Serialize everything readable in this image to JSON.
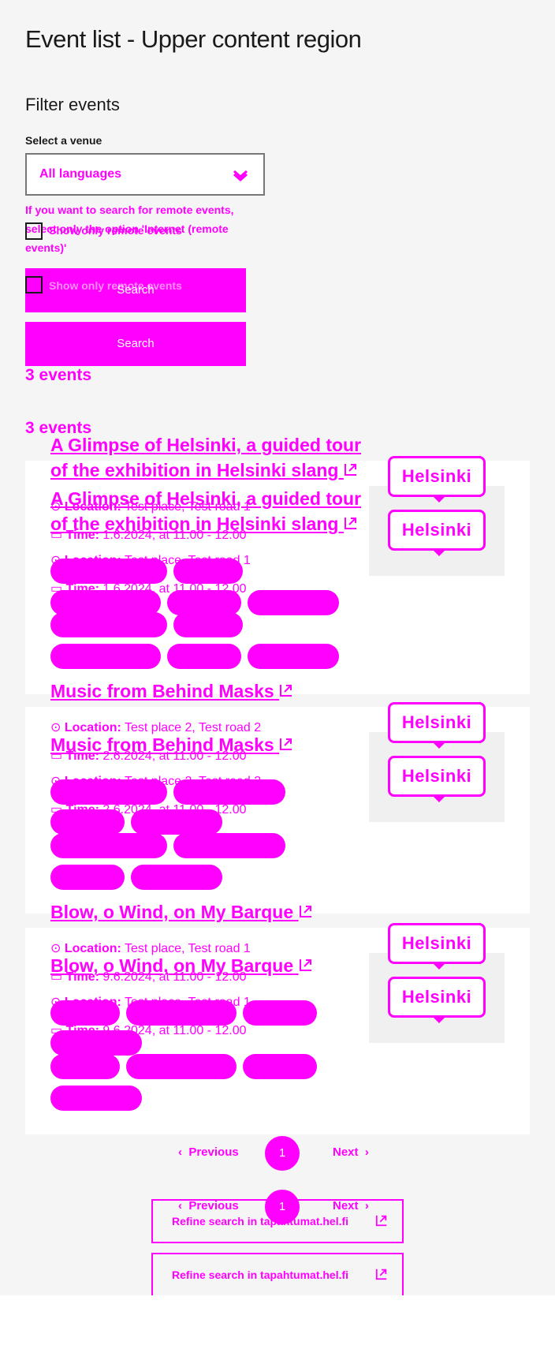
{
  "page": {
    "heading": "Event list - Upper content region"
  },
  "filters": {
    "heading": "Filter events",
    "venue_label": "Select a venue",
    "venue_value": "All languages",
    "helper_text": "If you want to search for remote events, select only the option 'Internet (remote events)'",
    "checkbox_label": "Show only remote events",
    "search_label": "Search"
  },
  "results": {
    "count_label": "3 events"
  },
  "events": [
    {
      "title_line1": "A Glimpse of Helsinki, a guided tour",
      "title_line2": "of the exhibition in Helsinki slang",
      "location_label": "Location:",
      "location_value": "Test place, Test road 1",
      "time_label": "Time:",
      "time_value": "1.6.2024, at 11.00 - 12.00",
      "logo_text": "Helsinki"
    },
    {
      "title_line1": "Music from Behind Masks",
      "location_label": "Location:",
      "location_value": "Test place 2, Test road 2",
      "time_label": "Time:",
      "time_value": "2.6.2024, at 11.00 - 12.00",
      "logo_text": "Helsinki"
    },
    {
      "title_line1": "Blow, o Wind, on My Barque",
      "location_label": "Location:",
      "location_value": "Test place, Test road 1",
      "time_label": "Time:",
      "time_value": "9.6.2024, at 11.00 - 12.00",
      "logo_text": "Helsinki"
    }
  ],
  "pagination": {
    "previous": "Previous",
    "current_page": "1",
    "next": "Next"
  },
  "refine": {
    "label": "Refine search in tapahtumat.hel.fi"
  },
  "colors": {
    "accent": "#ff00ff",
    "background": "#f5f5f5",
    "card": "#ffffff",
    "image_placeholder": "#f0f0f0"
  },
  "icons": [
    "chevron-down-icon",
    "external-link-icon",
    "location-icon",
    "calendar-icon",
    "chevron-left-icon",
    "chevron-right-icon"
  ]
}
